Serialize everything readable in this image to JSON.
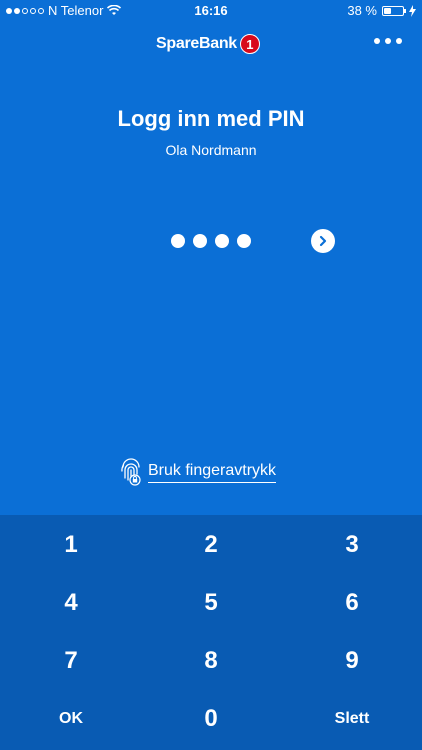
{
  "status_bar": {
    "carrier": "N Telenor",
    "time": "16:16",
    "battery_percent": "38 %",
    "battery_level": 0.38
  },
  "header": {
    "logo_text": "SpareBank",
    "logo_badge": "1"
  },
  "login": {
    "title": "Logg inn med PIN",
    "user_name": "Ola Nordmann",
    "pin_entered_count": 4,
    "fingerprint_label": "Bruk fingeravtrykk"
  },
  "keypad": {
    "keys": [
      "1",
      "2",
      "3",
      "4",
      "5",
      "6",
      "7",
      "8",
      "9",
      "OK",
      "0",
      "Slett"
    ]
  },
  "colors": {
    "background": "#0b6fd6",
    "keypad_background": "#095bb3",
    "logo_badge": "#d8091b"
  }
}
